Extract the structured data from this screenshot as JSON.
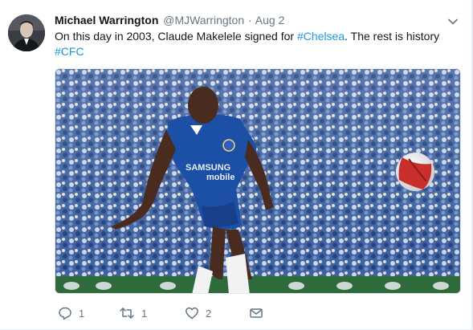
{
  "tweet": {
    "author_name": "Michael Warrington",
    "handle": "@MJWarrington",
    "separator": "·",
    "timestamp": "Aug 2",
    "text_main": "On this day in 2003, Claude Makelele signed for ",
    "hashtag_chelsea": "#Chelsea",
    "text_after": ". The rest is history",
    "hashtag_cfc": "#CFC",
    "media_kit_sponsor_line1": "SAMSUNG",
    "media_kit_sponsor_line2": "mobile"
  },
  "actions": {
    "reply_count": "1",
    "retweet_count": "1",
    "like_count": "2"
  },
  "icons": {
    "reply": "reply-icon",
    "retweet": "retweet-icon",
    "like": "heart-icon",
    "dm": "envelope-icon",
    "menu": "chevron-down-icon"
  },
  "colors": {
    "link": "#1b95e0",
    "secondary_text": "#657786",
    "primary_text": "#14171a"
  }
}
